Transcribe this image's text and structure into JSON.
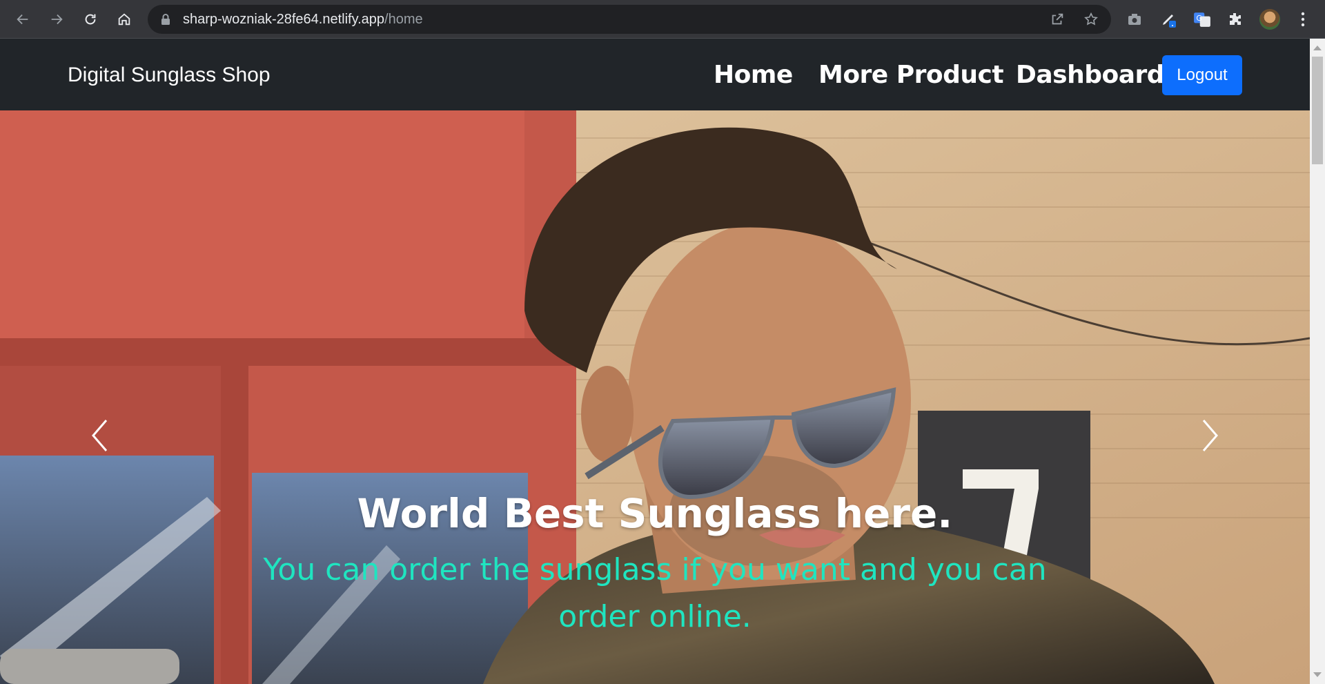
{
  "browser": {
    "url_host": "sharp-wozniak-28fe64.netlify.app",
    "url_path": "/home",
    "icons": [
      "back-icon",
      "forward-icon",
      "reload-icon",
      "home-icon",
      "lock-icon",
      "share-icon",
      "bookmark-star-icon",
      "camera-icon",
      "pen-extension-icon",
      "translate-icon",
      "extensions-puzzle-icon",
      "profile-avatar",
      "kebab-menu-icon"
    ]
  },
  "navbar": {
    "brand": "Digital Sunglass Shop",
    "links": [
      "Home",
      "More Product",
      "Dashboard"
    ],
    "logout": "Logout"
  },
  "hero": {
    "title": "World Best Sunglass here.",
    "subtitle": "You can order the sunglass if you want and you can order online.",
    "controls": [
      "carousel-prev-icon",
      "carousel-next-icon"
    ]
  },
  "colors": {
    "navbar_bg": "#212529",
    "logout_bg": "#0d6efd",
    "subtitle_color": "#1fe5c0"
  }
}
